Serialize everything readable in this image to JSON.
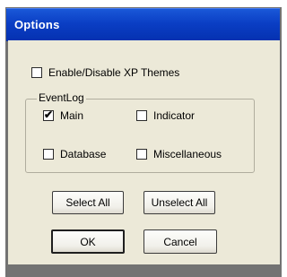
{
  "window": {
    "title": "Options"
  },
  "themes": {
    "label": "Enable/Disable XP Themes",
    "checked": false
  },
  "eventlog": {
    "label": "EventLog",
    "items": [
      {
        "label": "Main",
        "checked": true
      },
      {
        "label": "Indicator",
        "checked": false
      },
      {
        "label": "Database",
        "checked": false
      },
      {
        "label": "Miscellaneous",
        "checked": false
      }
    ]
  },
  "buttons": {
    "select_all": "Select All",
    "unselect_all": "Unselect All",
    "ok": "OK",
    "cancel": "Cancel"
  },
  "check_glyph": "✔"
}
